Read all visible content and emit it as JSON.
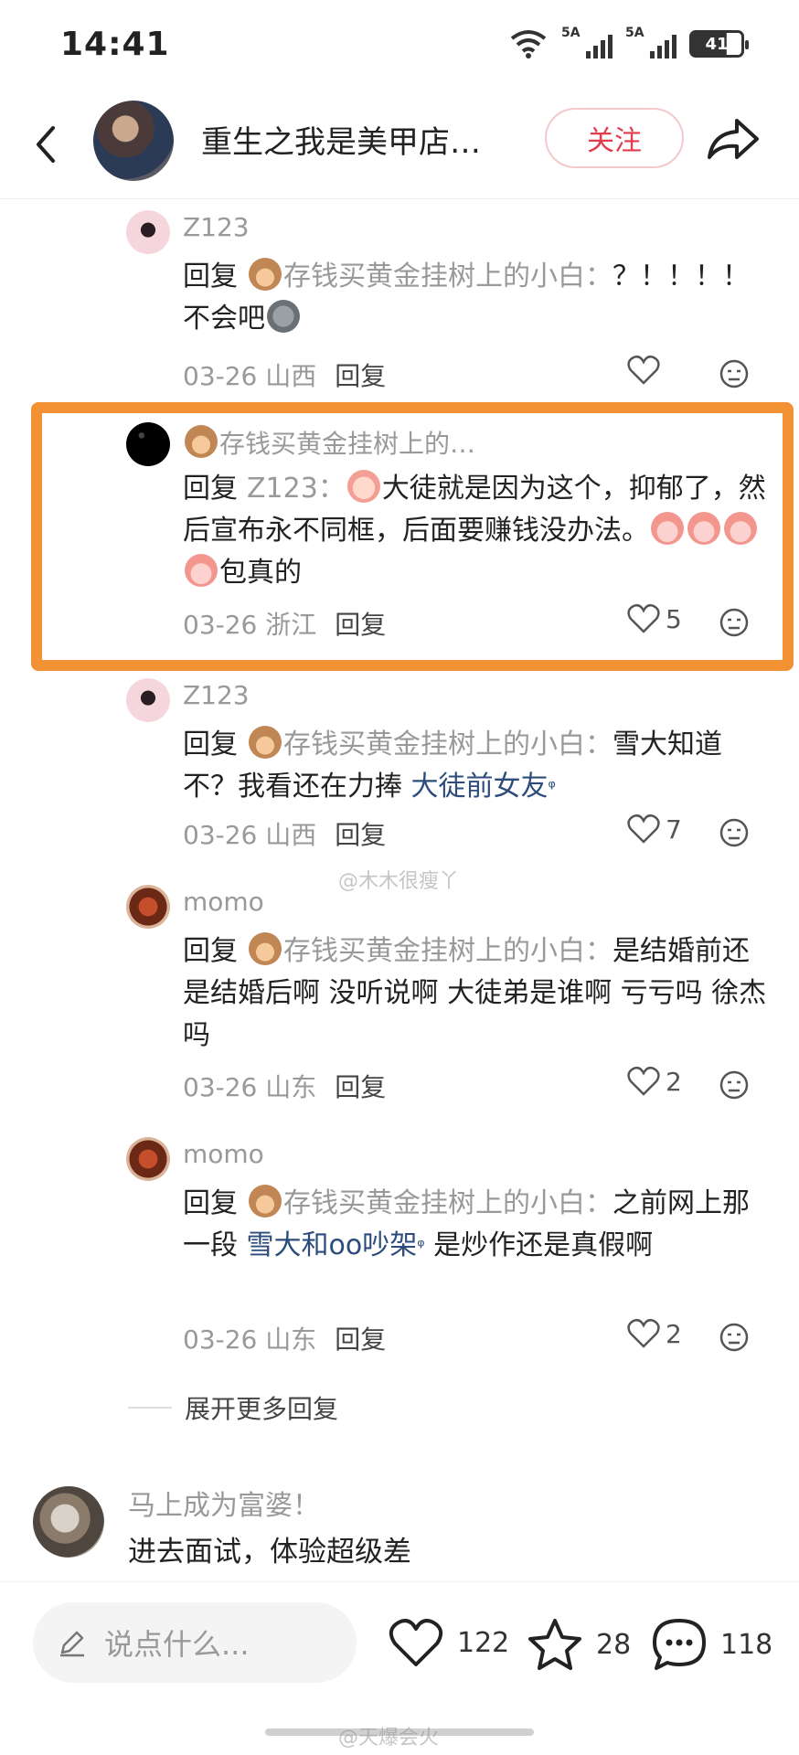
{
  "status_bar": {
    "time": "14:41",
    "signal1_label": "5A",
    "signal2_label": "5A",
    "battery": "41"
  },
  "header": {
    "title": "重生之我是美甲店…",
    "follow_label": "关注"
  },
  "replies": [
    {
      "name": "Z123",
      "reply_word": "回复",
      "target": "存钱买黄金挂树上的小白：",
      "text": "？！！！！ 不会吧",
      "date": "03-26",
      "region": "山西",
      "reply_label": "回复",
      "likes": ""
    },
    {
      "name": "存钱买黄金挂树上的…",
      "reply_word": "回复",
      "target": "Z123：",
      "text": "大徒就是因为这个，抑郁了，然后宣布永不同框，后面要赚钱没办法。",
      "text_tail": "包真的",
      "date": "03-26",
      "region": "浙江",
      "reply_label": "回复",
      "likes": "5"
    },
    {
      "name": "Z123",
      "reply_word": "回复",
      "target": "存钱买黄金挂树上的小白：",
      "text": "雪大知道不？我看还在力捧",
      "link": "大徒前女友",
      "date": "03-26",
      "region": "山西",
      "reply_label": "回复",
      "likes": "7"
    },
    {
      "name": "momo",
      "reply_word": "回复",
      "target": "存钱买黄金挂树上的小白：",
      "text": "是结婚前还是结婚后啊 没听说啊 大徒弟是谁啊 亏亏吗 徐杰吗",
      "date": "03-26",
      "region": "山东",
      "reply_label": "回复",
      "likes": "2"
    },
    {
      "name": "momo",
      "reply_word": "回复",
      "target": "存钱买黄金挂树上的小白：",
      "text_pre": "之前网上那一段",
      "link": "雪大和oo吵架",
      "text_post": "是炒作还是真假啊",
      "date": "03-26",
      "region": "山东",
      "reply_label": "回复",
      "likes": "2"
    }
  ],
  "expand_more": "展开更多回复",
  "next_comment": {
    "name": "马上成为富婆！",
    "text": "进去面试，体验超级差"
  },
  "bottom_bar": {
    "input_placeholder": "说点什么...",
    "likes": "122",
    "favorites": "28",
    "comments": "118"
  },
  "watermarks": {
    "middle": "@木木很瘦丫",
    "bottom": "@天爆会火"
  },
  "colors": {
    "highlight": "#f39234",
    "follow": "#e23b4b",
    "link": "#2c4c7c"
  }
}
